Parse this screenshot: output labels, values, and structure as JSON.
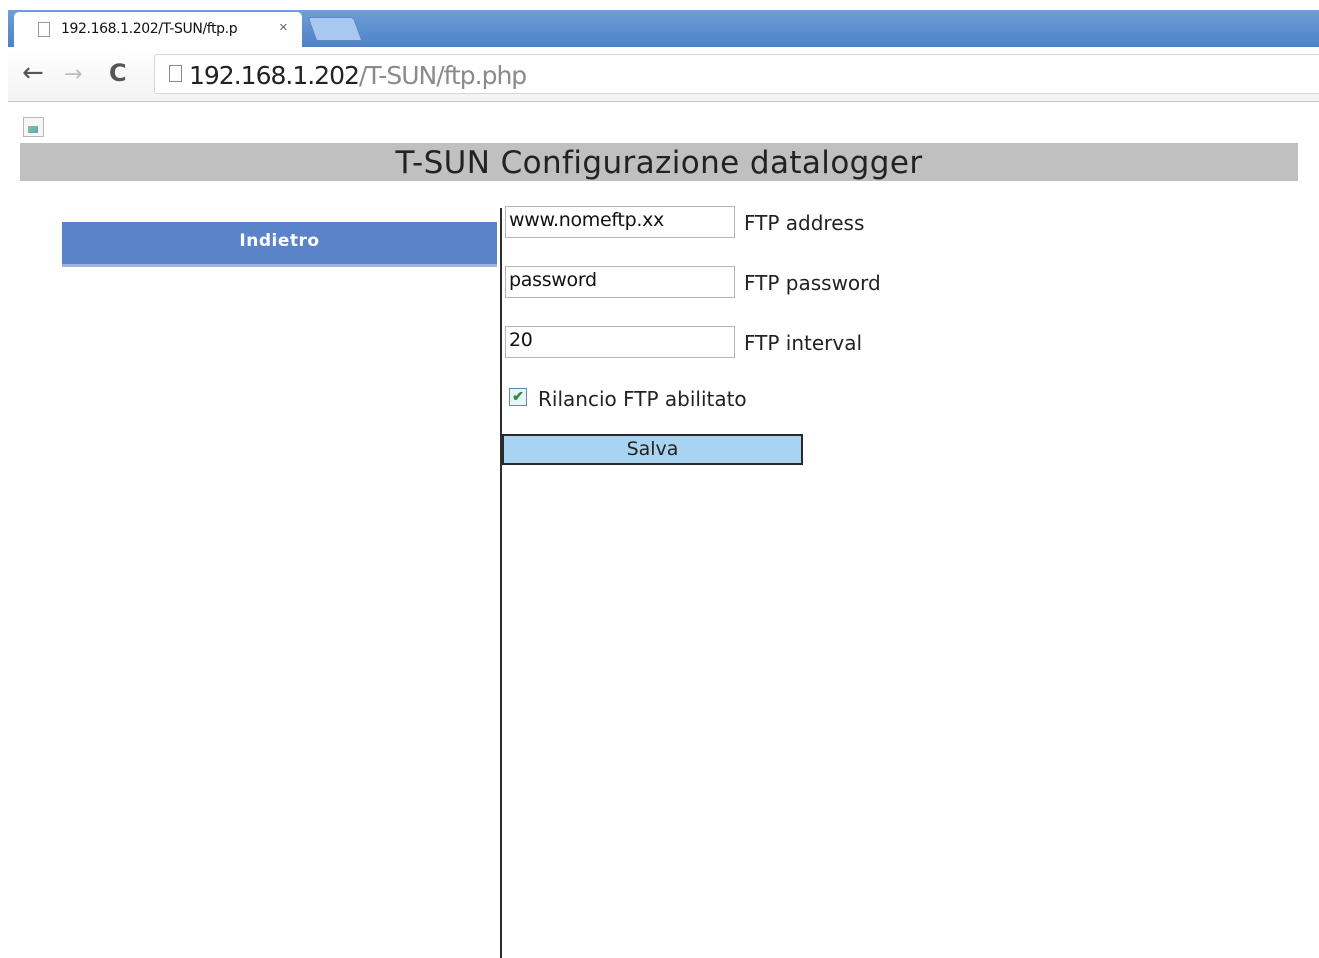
{
  "browser": {
    "tab_title": "192.168.1.202/T-SUN/ftp.p",
    "tab_close": "×",
    "url_host": "192.168.1.202",
    "url_path": "/T-SUN/ftp.php",
    "back_glyph": "←",
    "forward_glyph": "→",
    "reload_glyph": "C"
  },
  "page": {
    "title": "T-SUN Configurazione datalogger",
    "back_button": "Indietro",
    "fields": [
      {
        "value": "www.nomeftp.xx",
        "label": "FTP address"
      },
      {
        "value": "password",
        "label": "FTP password"
      },
      {
        "value": "20",
        "label": "FTP interval"
      }
    ],
    "checkbox": {
      "label": "Rilancio FTP abilitato",
      "checked": true,
      "mark": "✔"
    },
    "save_button": "Salva"
  },
  "colors": {
    "header_bg": "#c0c0c0",
    "back_button_bg": "#5b83c9",
    "save_button_bg": "#a8d4f1"
  },
  "icons": [
    "page-icon",
    "back-arrow-icon",
    "forward-arrow-icon",
    "reload-icon",
    "broken-image-icon",
    "close-icon"
  ]
}
